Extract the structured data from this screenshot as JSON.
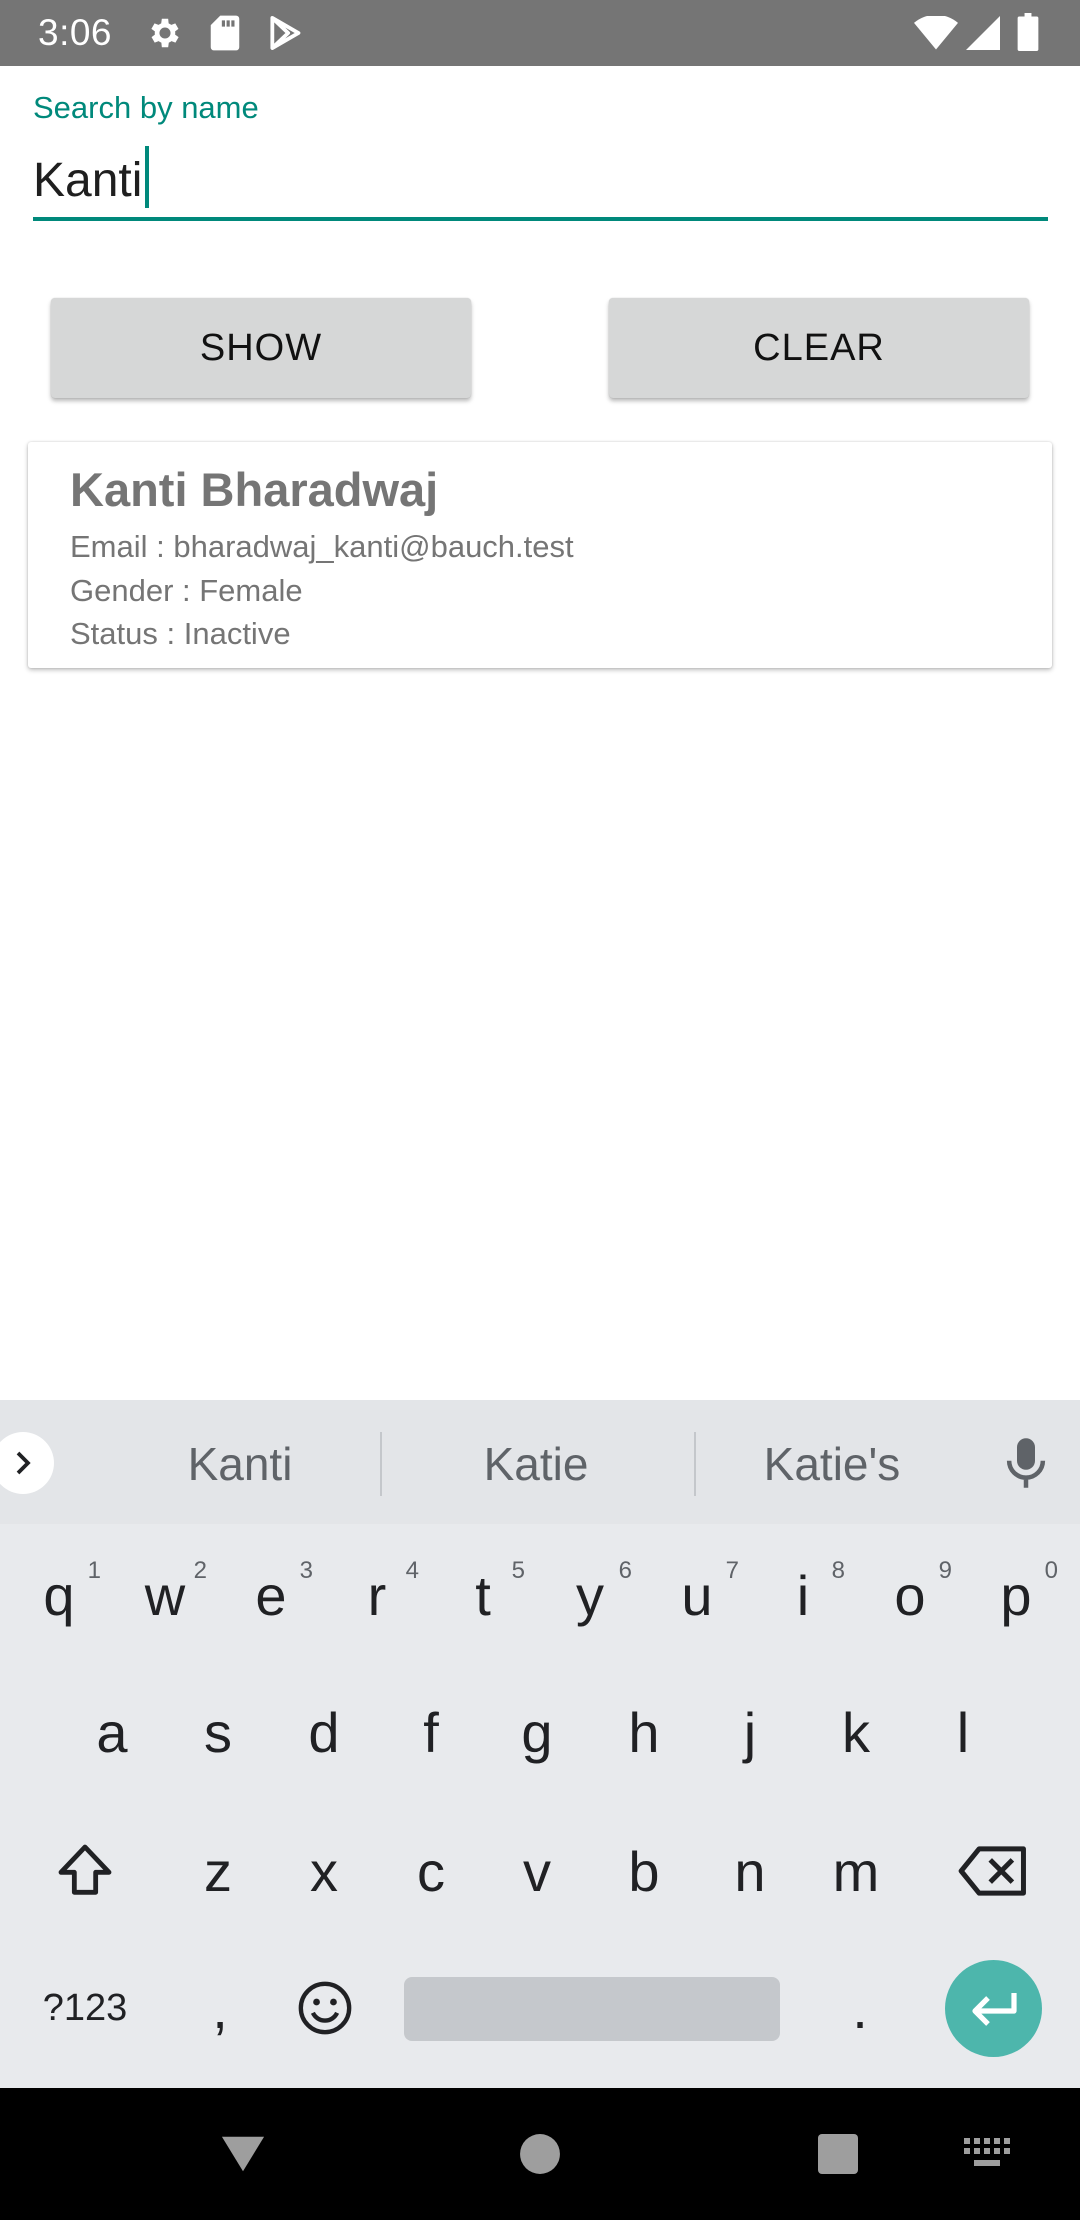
{
  "status_bar": {
    "time": "3:06",
    "icons": [
      "gear-icon",
      "sd-card-icon",
      "play-store-icon",
      "wifi-icon",
      "signal-icon",
      "battery-icon"
    ]
  },
  "search": {
    "label": "Search by name",
    "value": "Kanti",
    "accent_color": "#00897b"
  },
  "buttons": {
    "show_label": "SHOW",
    "clear_label": "CLEAR"
  },
  "result": {
    "name": "Kanti Bharadwaj",
    "email": "Email : bharadwaj_kanti@bauch.test",
    "gender": "Gender : Female",
    "status": "Status : Inactive"
  },
  "keyboard": {
    "suggestions": [
      "Kanti",
      "Katie",
      "Katie's"
    ],
    "row1": [
      {
        "char": "q",
        "hint": "1"
      },
      {
        "char": "w",
        "hint": "2"
      },
      {
        "char": "e",
        "hint": "3"
      },
      {
        "char": "r",
        "hint": "4"
      },
      {
        "char": "t",
        "hint": "5"
      },
      {
        "char": "y",
        "hint": "6"
      },
      {
        "char": "u",
        "hint": "7"
      },
      {
        "char": "i",
        "hint": "8"
      },
      {
        "char": "o",
        "hint": "9"
      },
      {
        "char": "p",
        "hint": "0"
      }
    ],
    "row2": [
      "a",
      "s",
      "d",
      "f",
      "g",
      "h",
      "j",
      "k",
      "l"
    ],
    "row3": [
      "z",
      "x",
      "c",
      "v",
      "b",
      "n",
      "m"
    ],
    "symbols_label": "?123",
    "comma": ",",
    "period": ".",
    "enter_color": "#4db6ac"
  },
  "nav_bar": {
    "icons": [
      "back-icon",
      "home-icon",
      "recents-icon",
      "keyboard-switch-icon"
    ]
  }
}
